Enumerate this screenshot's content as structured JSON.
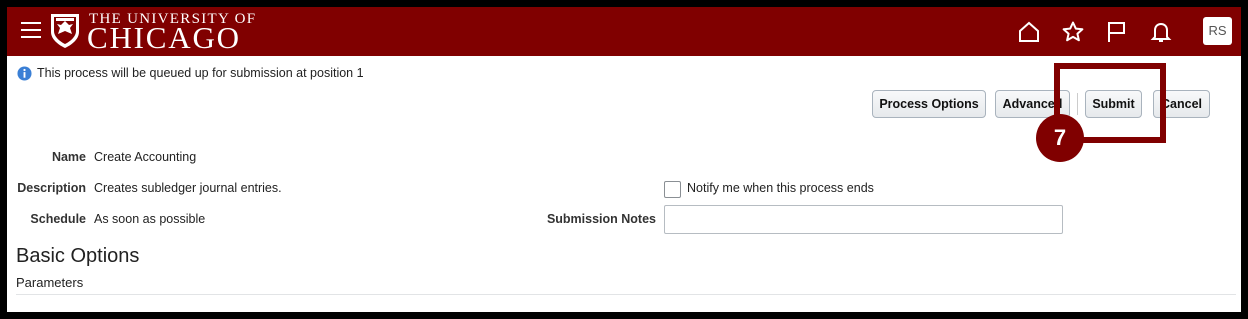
{
  "header": {
    "brand_line1": "THE UNIVERSITY OF",
    "brand_line2": "CHICAGO",
    "avatar_initials": "RS",
    "bar_color": "#800000"
  },
  "info_message": "This process will be queued up for submission at position 1",
  "toolbar": {
    "process_options": "Process Options",
    "advanced": "Advanced",
    "submit": "Submit",
    "cancel": "Cancel"
  },
  "annotation": {
    "step": "7",
    "color": "#800000"
  },
  "details": {
    "name_label": "Name",
    "name_value": "Create Accounting",
    "description_label": "Description",
    "description_value": "Creates subledger journal entries.",
    "schedule_label": "Schedule",
    "schedule_value": "As soon as possible",
    "notify_label": "Notify me when this process ends",
    "notify_checked": false,
    "submission_notes_label": "Submission Notes",
    "submission_notes_value": ""
  },
  "section": {
    "title": "Basic Options",
    "subtitle": "Parameters"
  }
}
